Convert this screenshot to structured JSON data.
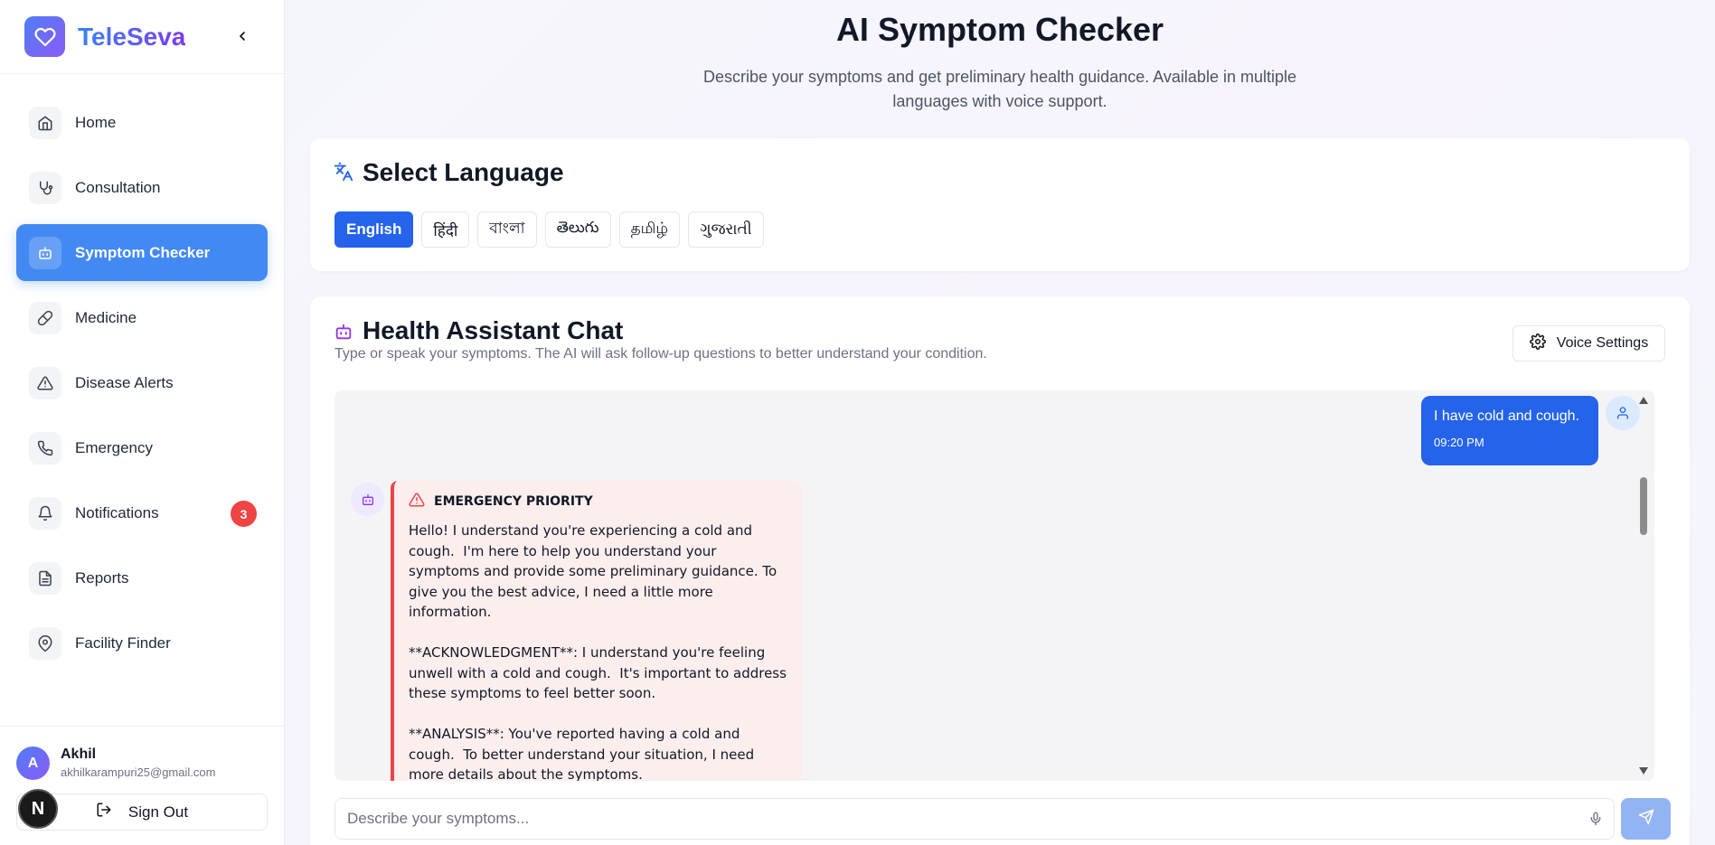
{
  "app": {
    "name": "TeleSeva"
  },
  "sidebar": {
    "items": [
      {
        "label": "Home",
        "icon": "home-icon"
      },
      {
        "label": "Consultation",
        "icon": "stethoscope-icon"
      },
      {
        "label": "Symptom Checker",
        "icon": "bot-icon",
        "active": true
      },
      {
        "label": "Medicine",
        "icon": "pill-icon"
      },
      {
        "label": "Disease Alerts",
        "icon": "alert-triangle-icon"
      },
      {
        "label": "Emergency",
        "icon": "phone-icon"
      },
      {
        "label": "Notifications",
        "icon": "bell-icon",
        "badge": "3"
      },
      {
        "label": "Reports",
        "icon": "file-text-icon"
      },
      {
        "label": "Facility Finder",
        "icon": "map-pin-icon"
      }
    ],
    "user": {
      "initial": "A",
      "name": "Akhil",
      "email": "akhilkarampuri25@gmail.com"
    },
    "signout_label": "Sign Out"
  },
  "page": {
    "title": "AI Symptom Checker",
    "subtitle": "Describe your symptoms and get preliminary health guidance. Available in multiple languages with voice support."
  },
  "language": {
    "title": "Select Language",
    "options": [
      "English",
      "हिंदी",
      "বাংলা",
      "తెలుగు",
      "தமிழ்",
      "ગુજરાતી"
    ],
    "selected": "English"
  },
  "chat": {
    "title": "Health Assistant Chat",
    "subtitle": "Type or speak your symptoms. The AI will ask follow-up questions to better understand your condition.",
    "voice_settings_label": "Voice Settings",
    "user_message": {
      "text": "I have cold and cough.",
      "time": "09:20 PM"
    },
    "bot_message": {
      "priority": "EMERGENCY PRIORITY",
      "body": "Hello! I understand you're experiencing a cold and cough.  I'm here to help you understand your symptoms and provide some preliminary guidance. To give you the best advice, I need a little more information.\n\n**ACKNOWLEDGMENT**: I understand you're feeling unwell with a cold and cough.  It's important to address these symptoms to feel better soon.\n\n**ANALYSIS**: You've reported having a cold and cough.  To better understand your situation, I need more details about the symptoms."
    },
    "input_placeholder": "Describe your symptoms..."
  },
  "colors": {
    "accent": "#2563eb",
    "active_nav": "#4289f3",
    "alert": "#ef4444"
  }
}
